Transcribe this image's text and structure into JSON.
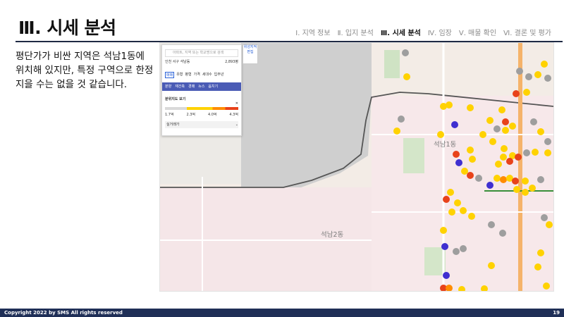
{
  "slide": {
    "title": "Ⅲ. 시세 분석",
    "nav": [
      {
        "label": "Ⅰ. 지역 정보",
        "active": false
      },
      {
        "label": "Ⅱ. 입지 분석",
        "active": false
      },
      {
        "label": "Ⅲ. 시세 분석",
        "active": true
      },
      {
        "label": "Ⅳ. 임장",
        "active": false
      },
      {
        "label": "Ⅴ. 매물 확인",
        "active": false
      },
      {
        "label": "Ⅵ. 결론 및 평가",
        "active": false
      }
    ],
    "body_text": "평단가가 비싼 지역은 석남1동에 위치해 있지만, 특정 구역으로 한정 지을 수는 없을 것 같습니다.",
    "footer_copyright": "Copyright 2022 by SMS  All rights reserved",
    "page_number": "19"
  },
  "map": {
    "labels": [
      "석남1동",
      "석남2동"
    ],
    "panel": {
      "search_placeholder": "아파트, 지역 또는 학교명으로 검색",
      "location": "인천 서구 석남동",
      "price": "2,893평",
      "filters": [
        "매매",
        "유형",
        "평형",
        "가격",
        "세대수",
        "입주년"
      ],
      "tabs": [
        "분양",
        "재건축",
        "경매",
        "뉴스",
        "옵치기"
      ],
      "section_title": "분위지도 보기",
      "legend_values": [
        "1.7억",
        "2.3억",
        "4.0억",
        "4.3억"
      ],
      "dropdown": "실거래가"
    },
    "map_button": "위성지적편집",
    "colors": {
      "yellow": "#ffd200",
      "orange": "#ff8c00",
      "red": "#e8421a",
      "gray": "#9e9e9e",
      "blue": "#3f2fd0"
    }
  }
}
